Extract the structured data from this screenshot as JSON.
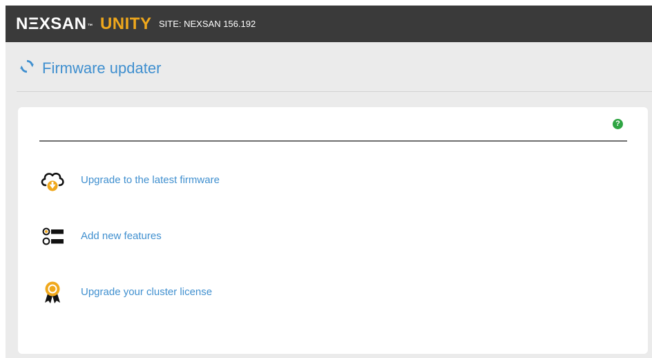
{
  "brand": {
    "name": "NΞXSAN",
    "trademark": "™",
    "product": "UNITY"
  },
  "site": {
    "label": "SITE: NEXSAN 156.192"
  },
  "page": {
    "title": "Firmware updater",
    "icon": "refresh-icon"
  },
  "help": {
    "label": "?",
    "icon": "help-icon"
  },
  "actions": [
    {
      "label": "Upgrade to the latest firmware",
      "icon": "cloud-download-icon"
    },
    {
      "label": "Add new features",
      "icon": "feature-list-icon"
    },
    {
      "label": "Upgrade your cluster license",
      "icon": "license-badge-icon"
    }
  ],
  "colors": {
    "topbar": "#3a3a3a",
    "accent_orange": "#f0a81c",
    "link_blue": "#3f8fcf",
    "help_green": "#2fa543",
    "background": "#ebebeb"
  }
}
